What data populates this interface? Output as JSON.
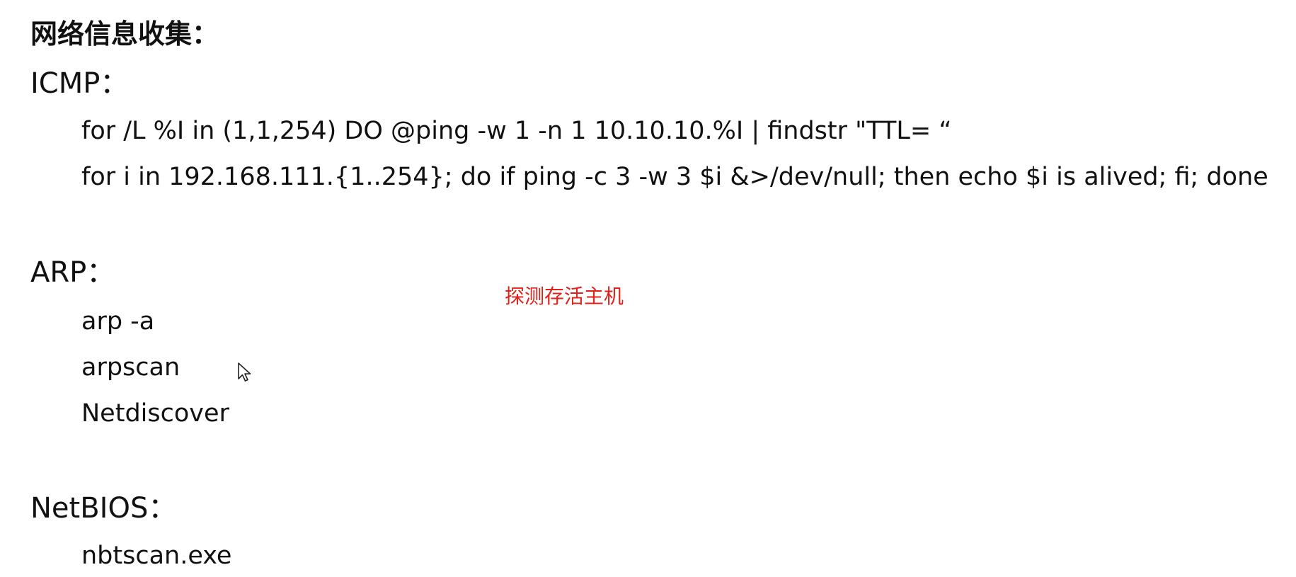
{
  "title": "网络信息收集：",
  "sections": {
    "icmp": {
      "heading": "ICMP：",
      "lines": [
        "for /L %I in (1,1,254) DO @ping -w 1 -n 1 10.10.10.%I | findstr \"TTL= “",
        "for i in 192.168.111.{1..254}; do if ping -c 3 -w 3 $i &>/dev/null; then echo $i is alived; fi; done"
      ]
    },
    "arp": {
      "heading": "ARP：",
      "lines": [
        "arp -a",
        "arpscan",
        "Netdiscover"
      ]
    },
    "netbios": {
      "heading": "NetBIOS：",
      "lines": [
        "nbtscan.exe"
      ]
    }
  },
  "annotation": "探测存活主机",
  "icons": {
    "cursor": "mouse-pointer-icon"
  },
  "colors": {
    "annotation": "#e0201b",
    "text": "#111111",
    "background": "#ffffff"
  }
}
